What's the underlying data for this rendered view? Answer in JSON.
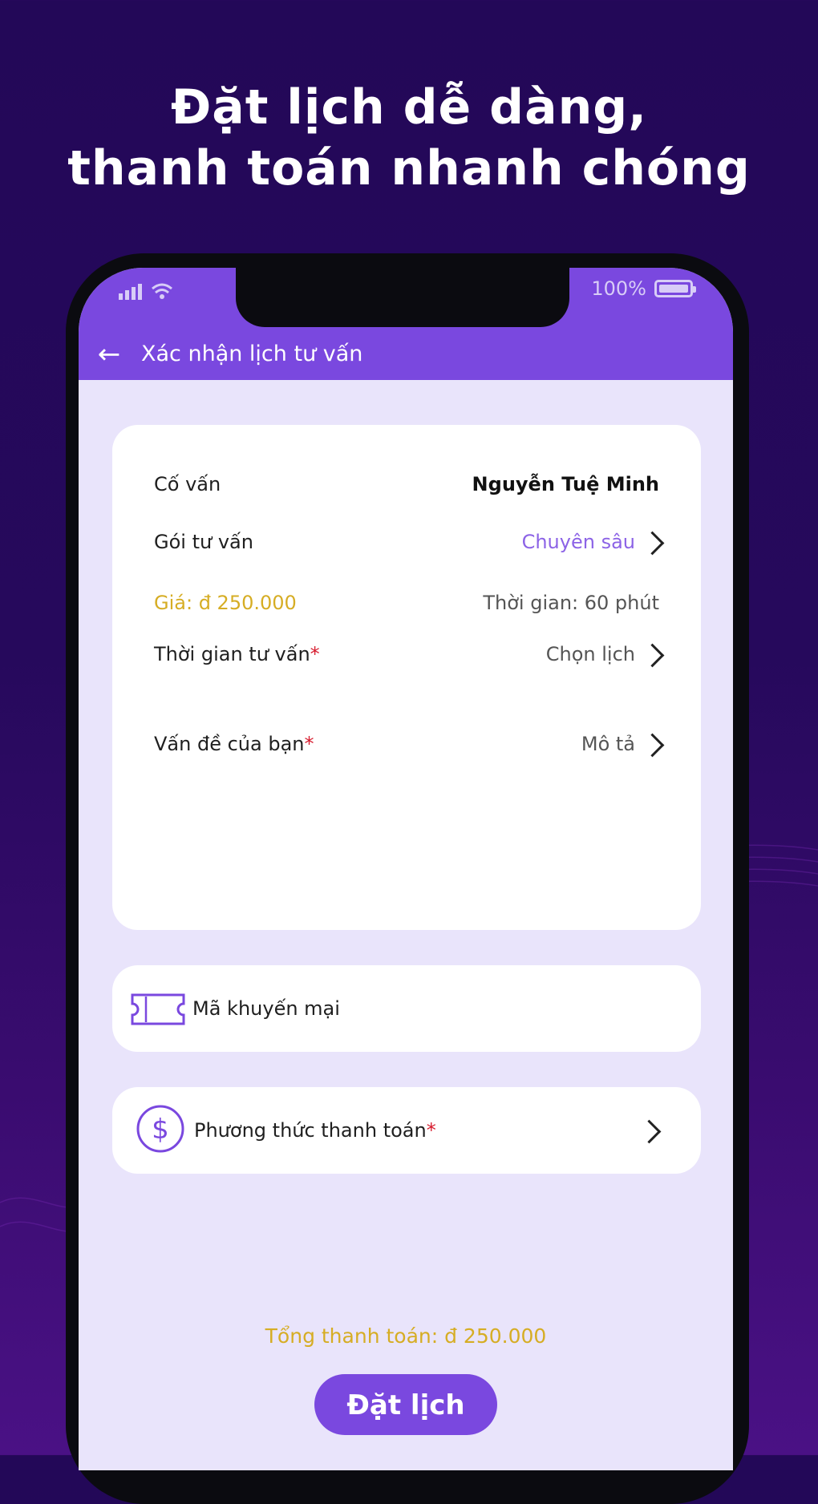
{
  "headline": {
    "line1": "Đặt lịch dễ dàng,",
    "line2": "thanh toán nhanh chóng"
  },
  "status_bar": {
    "battery_text": "100%"
  },
  "app_bar": {
    "title": "Xác nhận lịch tư vấn"
  },
  "details": {
    "advisor_label": "Cố vấn",
    "advisor_value": "Nguyễn Tuệ Minh",
    "package_label": "Gói tư vấn",
    "package_value": "Chuyên sâu",
    "price_text": "Giá: đ 250.000",
    "duration_text": "Thời gian: 60 phút",
    "time_label": "Thời gian tư vấn",
    "time_value": "Chọn lịch",
    "issue_label": "Vấn đề của bạn",
    "issue_value": "Mô tả",
    "required_mark": "*"
  },
  "promo": {
    "label": "Mã khuyến mại"
  },
  "payment": {
    "label": "Phương thức thanh toán",
    "required_mark": "*"
  },
  "total": {
    "text": "Tổng thanh toán: đ 250.000"
  },
  "book_button": {
    "label": "Đặt lịch"
  },
  "colors": {
    "primary": "#7a48df",
    "gold": "#d6ad24",
    "required": "#d71c2e",
    "background": "#26095c"
  }
}
